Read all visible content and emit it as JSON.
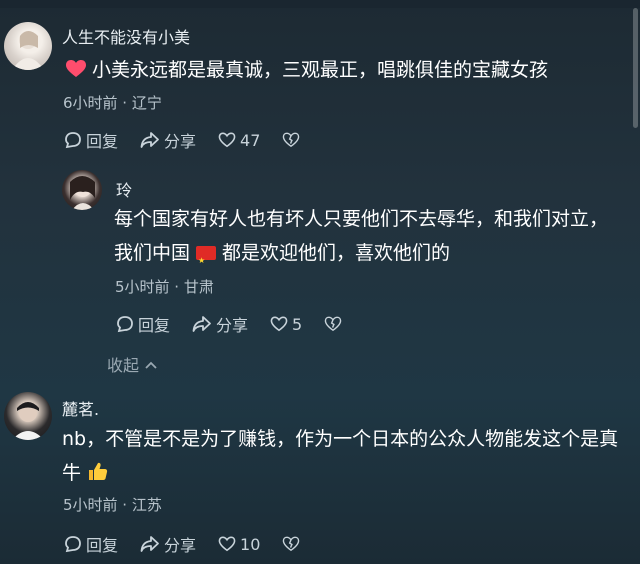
{
  "comments": [
    {
      "username": "人生不能没有小美",
      "text": "小美永远都是最真诚，三观最正，唱跳俱佳的宝藏女孩",
      "meta": "6小时前 · 辽宁",
      "reply_label": "回复",
      "share_label": "分享",
      "likes": "47"
    },
    {
      "username": "玲",
      "text_before_flag": "每个国家有好人也有坏人只要他们不去辱华，和我们对立，我们中国",
      "text_after_flag": "都是欢迎他们，喜欢他们的",
      "meta": "5小时前 · 甘肃",
      "reply_label": "回复",
      "share_label": "分享",
      "likes": "5"
    },
    {
      "username": "麓茗.",
      "text": "nb，不管是不是为了赚钱，作为一个日本的公众人物能发这个是真牛",
      "meta": "5小时前 · 江苏",
      "reply_label": "回复",
      "share_label": "分享",
      "likes": "10"
    }
  ],
  "collapse_label": "收起",
  "colors": {
    "heart": "#ff4d6d",
    "flag": "#e02b26",
    "meta": "#b7c3cb"
  }
}
